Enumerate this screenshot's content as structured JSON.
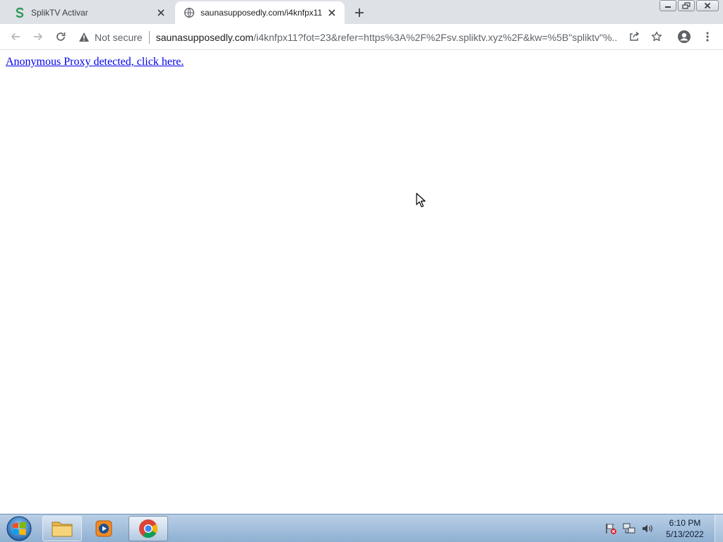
{
  "browser": {
    "tabs": [
      {
        "title": "SplikTV Activar",
        "active": false,
        "favicon": "spliktv-s-icon"
      },
      {
        "title": "saunasupposedly.com/i4knfpx11",
        "active": true,
        "favicon": "globe-icon"
      }
    ],
    "toolbar": {
      "security_label": "Not secure",
      "url_host": "saunasupposedly.com",
      "url_path": "/i4knfpx11?fot=23&refer=https%3A%2F%2Fsv.spliktv.xyz%2F&kw=%5B\"spliktv\"%..."
    }
  },
  "page": {
    "link_text": "Anonymous Proxy detected, click here."
  },
  "taskbar": {
    "clock_time": "6:10 PM",
    "clock_date": "5/13/2022",
    "items": [
      "file-explorer-icon",
      "media-player-icon",
      "chrome-icon"
    ]
  },
  "colors": {
    "link": "#0000ee",
    "tabstrip": "#dee1e6",
    "taskbar": "#a3bfdd"
  }
}
